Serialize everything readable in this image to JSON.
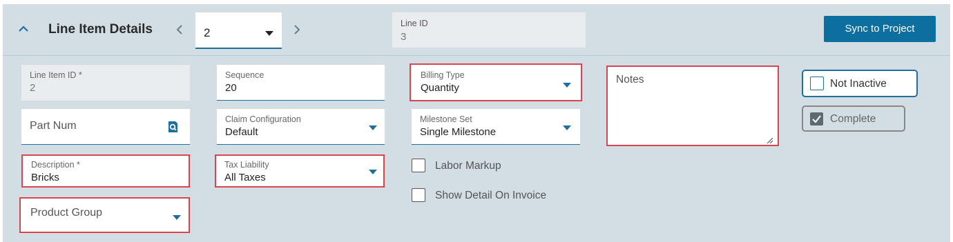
{
  "header": {
    "title": "Line Item Details",
    "collapse_icon": "chevron-up-icon",
    "prev_icon": "chevron-left-icon",
    "next_icon": "chevron-right-icon",
    "line_selector_value": "2",
    "line_id_label": "Line ID",
    "line_id_value": "3",
    "sync_button": "Sync to Project"
  },
  "form": {
    "line_item_id": {
      "label": "Line Item ID *",
      "value": "2"
    },
    "part_num": {
      "placeholder": "Part Num",
      "icon": "search-icon"
    },
    "description": {
      "label": "Description *",
      "value": "Bricks"
    },
    "product_group": {
      "placeholder": "Product Group"
    },
    "sequence": {
      "label": "Sequence",
      "value": "20"
    },
    "claim_configuration": {
      "label": "Claim Configuration",
      "value": "Default"
    },
    "tax_liability": {
      "label": "Tax Liability",
      "value": "All Taxes"
    },
    "billing_type": {
      "label": "Billing Type",
      "value": "Quantity"
    },
    "milestone_set": {
      "label": "Milestone Set",
      "value": "Single Milestone"
    },
    "labor_markup": {
      "label": "Labor Markup",
      "checked": false
    },
    "show_detail": {
      "label": "Show Detail On Invoice",
      "checked": false
    },
    "notes": {
      "placeholder": "Notes"
    },
    "not_inactive": {
      "label": "Not Inactive",
      "checked": false
    },
    "complete": {
      "label": "Complete",
      "checked": true
    }
  },
  "colors": {
    "accent": "#0d6ea0",
    "error": "#d9454d",
    "panel": "#d2dee3"
  }
}
